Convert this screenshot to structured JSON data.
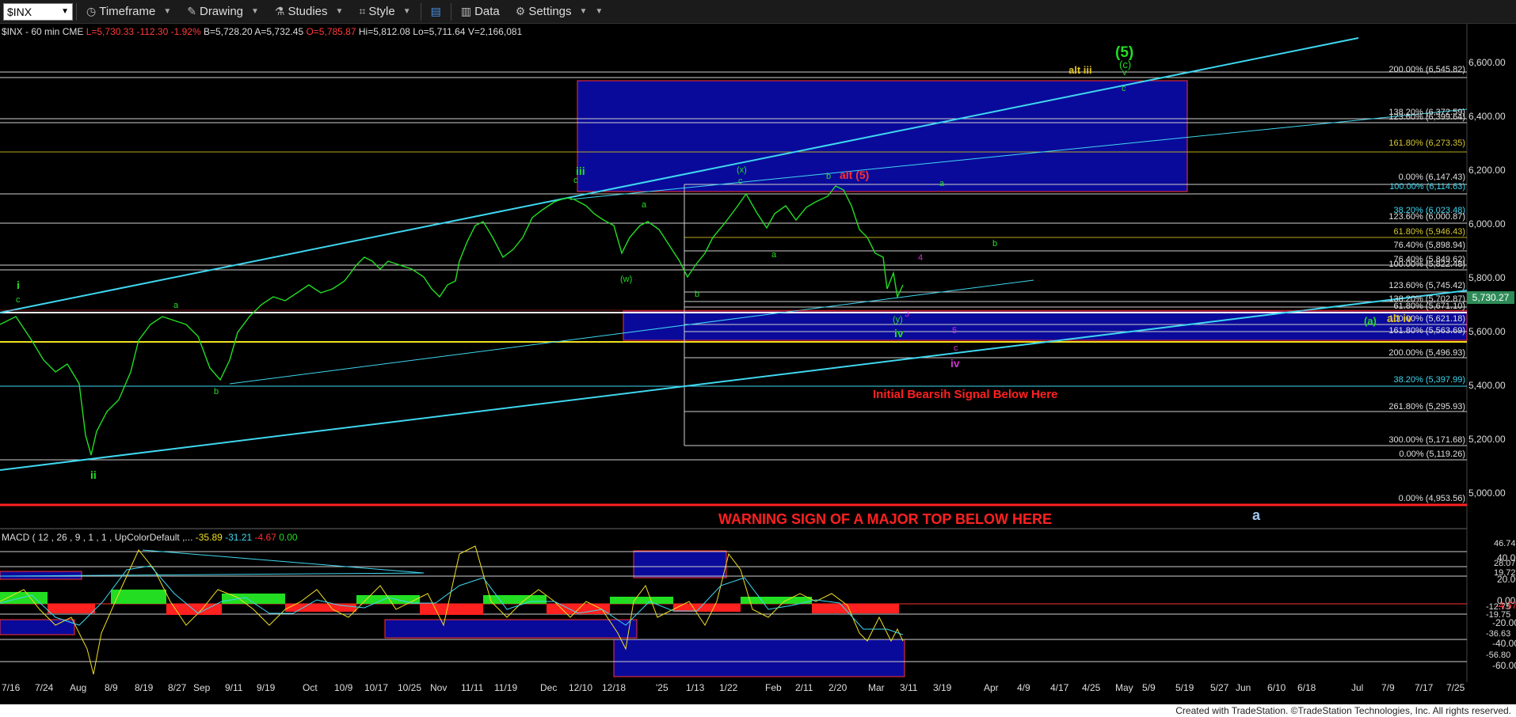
{
  "toolbar": {
    "symbol": "$INX",
    "buttons": [
      {
        "label": "Timeframe",
        "icon": "clock-icon"
      },
      {
        "label": "Drawing",
        "icon": "pencil-icon"
      },
      {
        "label": "Studies",
        "icon": "flask-icon"
      },
      {
        "label": "Style",
        "icon": "style-icon"
      },
      {
        "label": "Data",
        "icon": "bar-chart-icon"
      },
      {
        "label": "Settings",
        "icon": "gear-icon"
      }
    ]
  },
  "header": {
    "symbol": "$INX - 60 min  CME",
    "last": "L=5,730.33",
    "chg": "-112.30",
    "pct": "-1.92%",
    "bid": "B=5,728.20",
    "ask": "A=5,732.45",
    "open": "O=5,785.87",
    "hi": "Hi=5,812.08",
    "lo": "Lo=5,711.64",
    "vol": "V=2,166,081"
  },
  "macd_header": {
    "name": "MACD ( 12 , 26 , 9 , 1 , 1 , UpColorDefault ,... ",
    "v1": "-35.89",
    "v2": "-31.21",
    "v3": "-4.67",
    "v4": "0.00"
  },
  "price_axis": [
    "6,600.00",
    "6,400.00",
    "6,200.00",
    "6,000.00",
    "5,800.00",
    "5,600.00",
    "5,400.00",
    "5,200.00",
    "5,000.00"
  ],
  "last_price_tag": "5,730.27",
  "macd_axis": [
    "46.74",
    "40.00",
    "28.07",
    "20.00",
    "19.72",
    "0.00",
    "-4.67",
    "-12.75",
    "-19.75",
    "-20.00",
    "-36.63",
    "-40.00",
    "-56.80",
    "-60.00"
  ],
  "x_axis": [
    "7/16",
    "7/24",
    "Aug",
    "8/9",
    "8/19",
    "8/27",
    "Sep",
    "9/11",
    "9/19",
    "Oct",
    "10/9",
    "10/17",
    "10/25",
    "Nov",
    "11/11",
    "11/19",
    "Dec",
    "12/10",
    "12/18",
    "'25",
    "1/13",
    "1/22",
    "Feb",
    "2/11",
    "2/20",
    "Mar",
    "3/11",
    "3/19",
    "Apr",
    "4/9",
    "4/17",
    "4/25",
    "May",
    "5/9",
    "5/19",
    "5/27",
    "Jun",
    "6/10",
    "6/18",
    "Jul",
    "7/9",
    "7/17",
    "7/25"
  ],
  "fib_labels": [
    "200.00% (6,545.82)",
    "138.20% (6,372.59)",
    "123.60% (6,399.64)",
    "161.80% (6,273.35)",
    "0.00% (6,147.43)",
    "100.00% (6,114.63)",
    "38.20% (6,023.48)",
    "123.60% (6,000.87)",
    "61.80% (5,946.43)",
    "76.40% (5,898.94)",
    "76.40% (5,849.62)",
    "100.00% (5,822.48)",
    "123.60% (5,745.42)",
    "138.20% (5,702.87)",
    "61.80% (5,671.10)",
    "100.00% (5,621.18)",
    "161.80% (5,563.69)",
    "200.00% (5,496.93)",
    "38.20% (5,397.99)",
    "261.80% (5,295.93)",
    "300.00% (5,171.68)",
    "0.00% (5,119.26)",
    "0.00% (4,953.56)"
  ],
  "wave_labels": {
    "i": "i",
    "ii": "ii",
    "iii": "iii",
    "a": "a",
    "b": "b",
    "c": "c",
    "w": "(w)",
    "x": "(x)",
    "y": "(y)",
    "iv": "iv",
    "five_circle": "(5)",
    "c_circle": "(c)",
    "v": "v",
    "alt_iii": "alt iii",
    "alt_5": "alt (5)",
    "alt_iv": "alt iv",
    "four": "4",
    "three": "3",
    "five": "5",
    "big_a": "a",
    "a_circle": "(a)"
  },
  "annotations": {
    "bearish": "Initial Bearsih Signal Below Here",
    "warning": "WARNING SIGN OF A MAJOR TOP BELOW HERE"
  },
  "footer": "Created with TradeStation. ©TradeStation Technologies, Inc. All rights reserved.",
  "colors": {
    "price": "#22dd22",
    "trendline": "#3fd7f0",
    "box": "#0a0a9a",
    "warning": "#ff2020",
    "yellow": "#f0e020"
  }
}
